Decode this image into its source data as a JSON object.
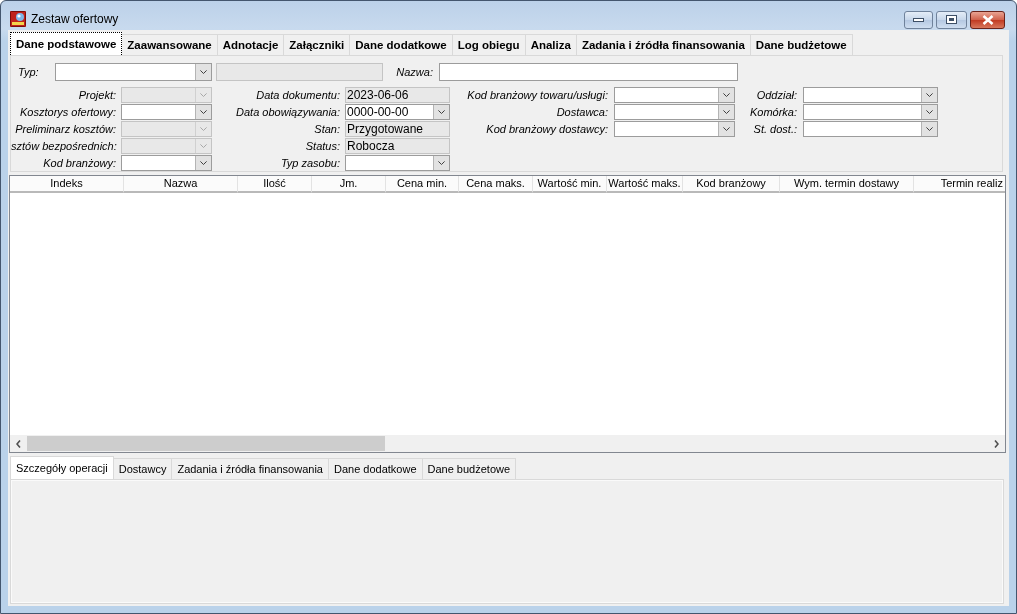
{
  "window": {
    "title": "Zestaw ofertowy"
  },
  "tabs": [
    {
      "label": "Dane podstawowe",
      "selected": true
    },
    {
      "label": "Zaawansowane",
      "selected": false
    },
    {
      "label": "Adnotacje",
      "selected": false
    },
    {
      "label": "Załączniki",
      "selected": false
    },
    {
      "label": "Dane dodatkowe",
      "selected": false
    },
    {
      "label": "Log obiegu",
      "selected": false
    },
    {
      "label": "Analiza",
      "selected": false
    },
    {
      "label": "Zadania i źródła finansowania",
      "selected": false
    },
    {
      "label": "Dane budżetowe",
      "selected": false
    }
  ],
  "form": {
    "top_row": [
      {
        "label": "Typ:",
        "kind": "combo",
        "disabled": false
      },
      {
        "kind": "text",
        "disabled": true
      },
      {
        "label": "Nazwa:",
        "kind": "text",
        "disabled": false
      }
    ],
    "columns": [
      {
        "fields": [
          {
            "label": "Projekt:",
            "kind": "combo",
            "disabled": true
          },
          {
            "label": "Kosztorys ofertowy:",
            "kind": "combo",
            "disabled": false
          },
          {
            "label": "Preliminarz kosztów:",
            "kind": "combo",
            "disabled": true
          },
          {
            "label": "sztów bezpośrednich:",
            "kind": "combo",
            "disabled": true
          },
          {
            "label": "Kod branżowy:",
            "kind": "combo",
            "disabled": false
          }
        ]
      },
      {
        "fields": [
          {
            "label": "Data dokumentu:",
            "kind": "text",
            "value": "2023-06-06",
            "disabled": true
          },
          {
            "label": "Data obowiązywania:",
            "kind": "combo",
            "value": "0000-00-00",
            "disabled": false
          },
          {
            "label": "Stan:",
            "kind": "text",
            "value": "Przygotowane",
            "disabled": true
          },
          {
            "label": "Status:",
            "kind": "text",
            "value": "Robocza",
            "disabled": true
          },
          {
            "label": "Typ zasobu:",
            "kind": "combo",
            "disabled": false
          }
        ]
      },
      {
        "fields": [
          {
            "label": "Kod branżowy towaru/usługi:",
            "kind": "combo",
            "disabled": false
          },
          {
            "label": "Dostawca:",
            "kind": "combo",
            "disabled": false
          },
          {
            "label": "Kod branżowy dostawcy:",
            "kind": "combo",
            "disabled": false
          }
        ]
      },
      {
        "fields": [
          {
            "label": "Oddział:",
            "kind": "combo",
            "disabled": false
          },
          {
            "label": "Komórka:",
            "kind": "combo",
            "disabled": false
          },
          {
            "label": "St. dost.:",
            "kind": "combo",
            "disabled": false
          }
        ]
      }
    ]
  },
  "table": {
    "columns": [
      "Indeks",
      "Nazwa",
      "Ilość",
      "Jm.",
      "Cena min.",
      "Cena maks.",
      "Wartość min.",
      "Wartość maks.",
      "Kod branżowy",
      "Wym. termin dostawy",
      "Termin realiz"
    ]
  },
  "detail_tabs": [
    {
      "label": "Szczegóły operacji",
      "selected": true
    },
    {
      "label": "Dostawcy",
      "selected": false
    },
    {
      "label": "Zadania i źródła finansowania",
      "selected": false
    },
    {
      "label": "Dane dodatkowe",
      "selected": false
    },
    {
      "label": "Dane budżetowe",
      "selected": false
    }
  ]
}
